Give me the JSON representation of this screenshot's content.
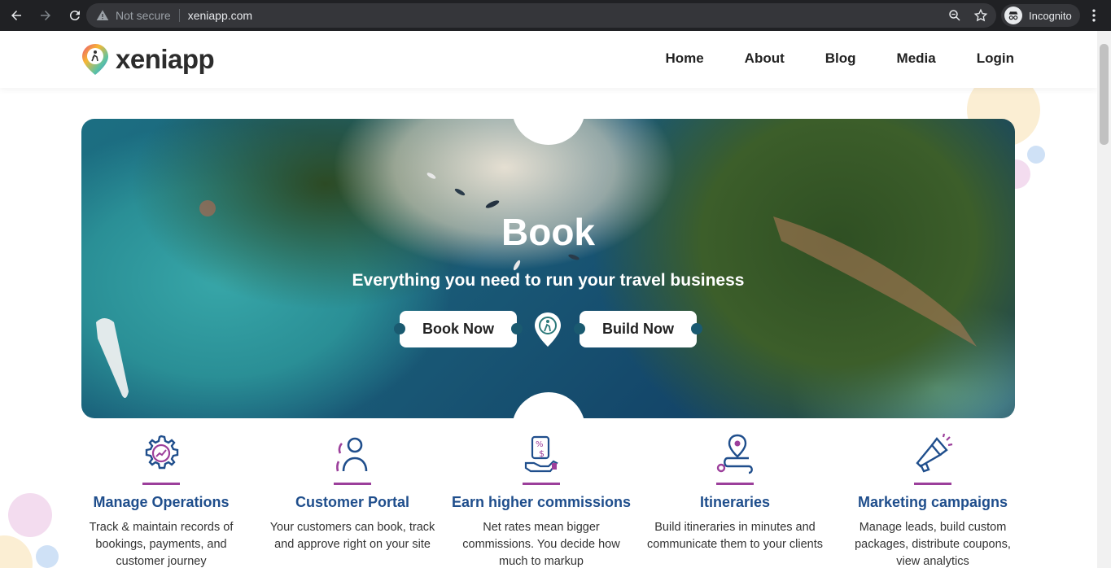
{
  "browser": {
    "security_label": "Not secure",
    "url": "xeniapp.com",
    "profile_label": "Incognito"
  },
  "site": {
    "logo_text": "xeniapp",
    "nav": [
      "Home",
      "About",
      "Blog",
      "Media",
      "Login"
    ]
  },
  "hero": {
    "title": "Book",
    "subtitle": "Everything you need to run your travel business",
    "book_button": "Book Now",
    "build_button": "Build Now"
  },
  "features": [
    {
      "icon": "gear-chart-icon",
      "title": "Manage Operations",
      "desc": "Track & maintain records of bookings, payments, and customer journey"
    },
    {
      "icon": "user-icon",
      "title": "Customer Portal",
      "desc": "Your customers can book, track and approve right on your site"
    },
    {
      "icon": "commission-icon",
      "title": "Earn higher commissions",
      "desc": "Net rates mean bigger commissions. You decide how much to markup"
    },
    {
      "icon": "route-pin-icon",
      "title": "Itineraries",
      "desc": "Build itineraries in minutes and communicate them to your clients"
    },
    {
      "icon": "megaphone-icon",
      "title": "Marketing campaigns",
      "desc": "Manage leads, build custom packages, distribute coupons, view analytics"
    }
  ],
  "colors": {
    "accent_purple": "#9c3f9b",
    "title_blue": "#1f4e8c",
    "chrome_bg": "#202124"
  }
}
